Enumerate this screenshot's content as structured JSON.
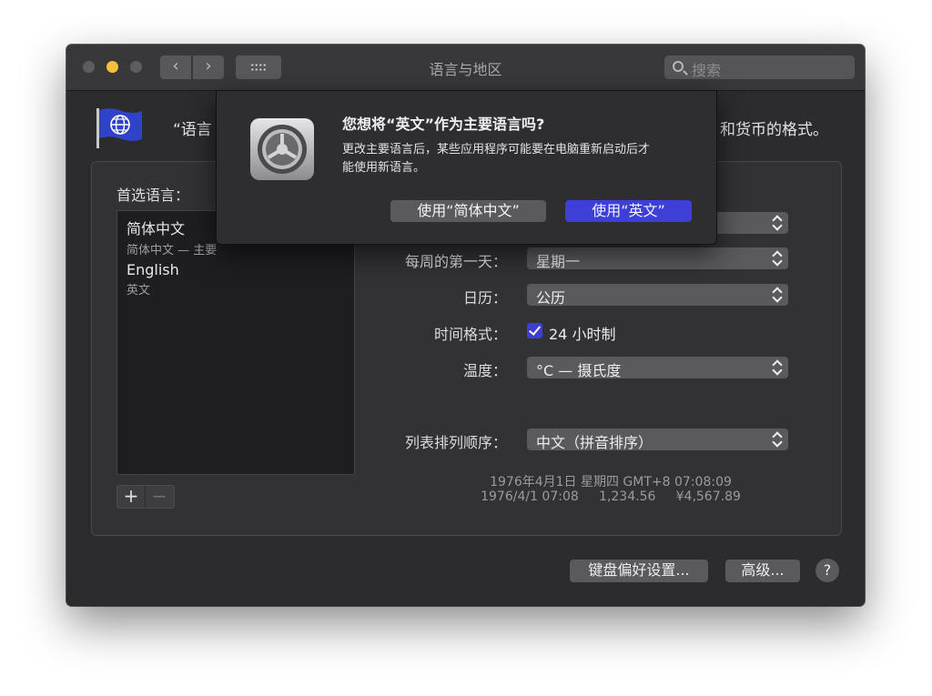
{
  "window": {
    "title": "语言与地区"
  },
  "search": {
    "placeholder": "搜索"
  },
  "header": {
    "left_text": "“语言",
    "right_text": "和货币的格式。"
  },
  "preferred": {
    "label": "首选语言：",
    "languages": [
      {
        "name": "简体中文",
        "sub": "简体中文 — 主要"
      },
      {
        "name": "English",
        "sub": "英文"
      }
    ],
    "add_label": "+",
    "remove_label": "−"
  },
  "settings": {
    "first_day_label": "每周的第一天：",
    "first_day_value": "星期一",
    "calendar_label": "日历：",
    "calendar_value": "公历",
    "time_format_label": "时间格式：",
    "time_format_value": "24 小时制",
    "time_format_checked": true,
    "temperature_label": "温度：",
    "temperature_value": "°C — 摄氏度",
    "sort_label": "列表排列顺序：",
    "sort_value": "中文（拼音排序）"
  },
  "sample": {
    "line1": "1976年4月1日 星期四 GMT+8 07:08:09",
    "line2": "1976/4/1 07:08     1,234.56     ¥4,567.89"
  },
  "buttons": {
    "keyboard": "键盘偏好设置...",
    "advanced": "高级...",
    "help": "?"
  },
  "dialog": {
    "title": "您想将“英文”作为主要语言吗?",
    "message_line1": "更改主要语言后，某些应用程序可能要在电脑重新启动后才",
    "message_line2": "能使用新语言。",
    "button_chinese": "使用“简体中文”",
    "button_english": "使用“英文”"
  },
  "colors": {
    "accent": "#3d3fd8",
    "window_bg": "#2c2b2e",
    "minimize": "#f4bf3a"
  }
}
